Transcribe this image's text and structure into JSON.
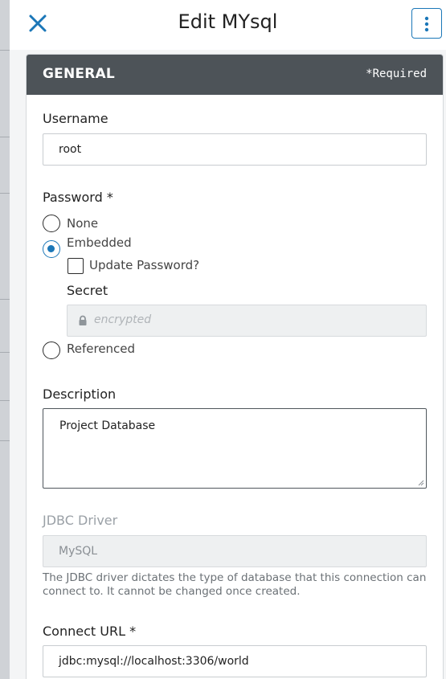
{
  "header": {
    "title": "Edit MYsql",
    "close_icon": "close-icon",
    "more_icon": "more-vertical-icon"
  },
  "section": {
    "title": "GENERAL",
    "required_note": "*Required"
  },
  "username": {
    "label": "Username",
    "value": "root"
  },
  "password": {
    "label": "Password *",
    "options": [
      "None",
      "Embedded",
      "Referenced"
    ],
    "selected": "Embedded",
    "update_password_label": "Update Password?",
    "secret_label": "Secret",
    "secret_placeholder": "encrypted"
  },
  "description": {
    "label": "Description",
    "value": "Project Database"
  },
  "jdbc": {
    "label": "JDBC Driver",
    "value": "MySQL",
    "help": "The JDBC driver dictates the type of database that this connection can connect to. It cannot be changed once created."
  },
  "connect_url": {
    "label": "Connect URL *",
    "value": "jdbc:mysql://localhost:3306/world"
  },
  "colors": {
    "accent": "#1b77b8",
    "section_header_bg": "#4d5358"
  }
}
